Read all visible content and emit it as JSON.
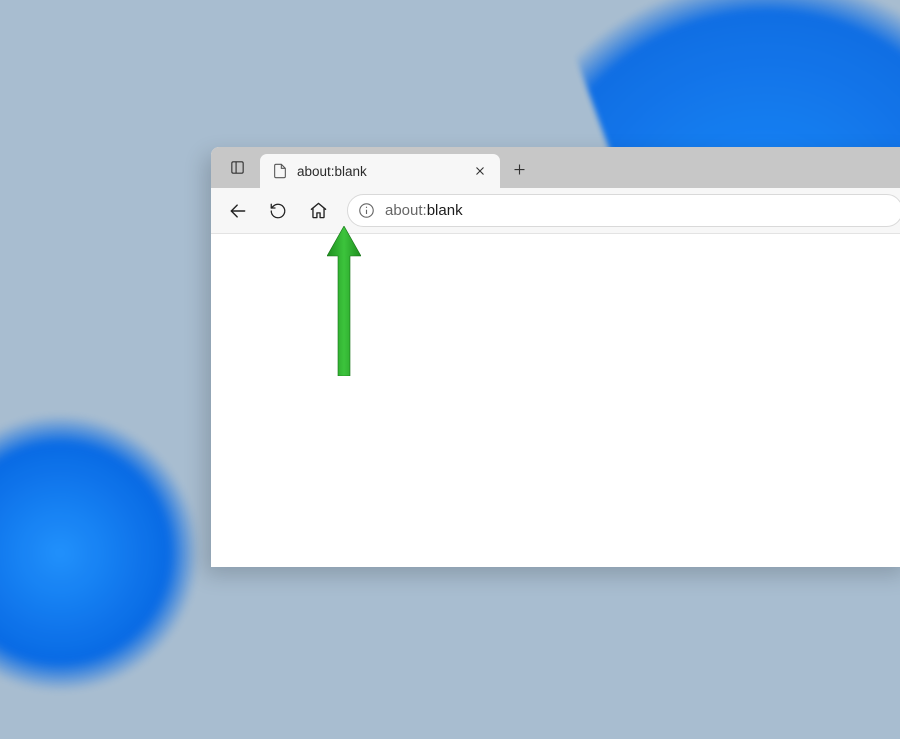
{
  "tabstrip": {
    "tab_title": "about:blank"
  },
  "addressbar": {
    "url_prefix": "about:",
    "url_highlight": "blank"
  },
  "annotation": {
    "arrow_color": "#2aa02a",
    "target": "home-button"
  }
}
